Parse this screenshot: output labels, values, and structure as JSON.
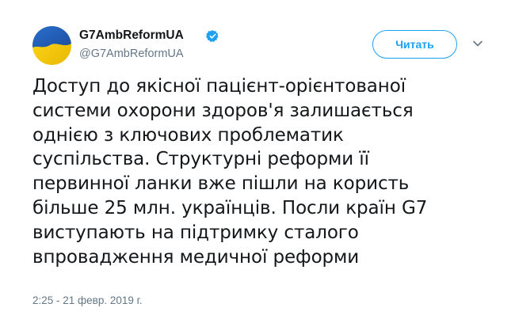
{
  "author": {
    "display_name": "G7AmbReformUA",
    "handle": "@G7AmbReformUA",
    "verified": true,
    "avatar": "ukraine-flag-avatar",
    "flag_colors": {
      "top": "#1f5fb8",
      "bottom": "#f7d117"
    }
  },
  "actions": {
    "follow_label": "Читать",
    "more_icon": "chevron-down-icon"
  },
  "tweet": {
    "lines": [
      "Доступ до якісної пацієнт-орієнтованої",
      "системи охорони здоров'я залишається",
      "однією з ключових проблематик",
      "суспільства. Структурні реформи її",
      "первинної ланки вже пішли на користь",
      "більше 25 млн. українців. Посли країн G7",
      "виступають на підтримку сталого",
      "впровадження медичної реформи"
    ],
    "timestamp": "2:25 - 21 февр. 2019 г."
  },
  "colors": {
    "accent": "#1da1f2",
    "text": "#14171a",
    "muted": "#657786"
  }
}
